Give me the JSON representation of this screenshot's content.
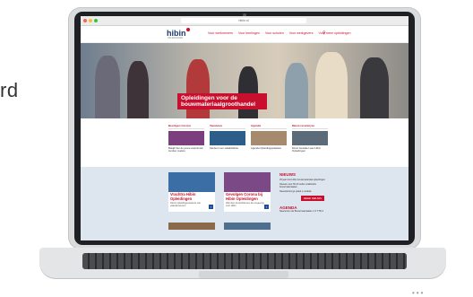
{
  "edge_text": "rd",
  "browser": {
    "url": "hibin.nl"
  },
  "site": {
    "logo": "hibin",
    "logo_sub": "OPLEIDINGEN",
    "menu": [
      "Voor werknemers",
      "Voor leerlingen",
      "Voor scholen",
      "Voor werkgevers",
      "Voor meer opleidingen"
    ],
    "hero_title": "Opleidingen voor de bouwmateriaalgroothandel",
    "cards": [
      {
        "heading": "Bevolgen Corona",
        "text": "Bekijk hier de jeune ewsmirnok tocofen zeelsro",
        "img_color": "#7a3f7c"
      },
      {
        "heading": "Vacatures",
        "text": "Student voor vakafdelinke",
        "img_color": "#2f5d8a"
      },
      {
        "heading": "Agenda",
        "text": "Agenda  Opleidingsplaatsen",
        "img_color": "#a58a6e"
      },
      {
        "heading": "Meest recentnyze",
        "text": "Direct bestellen aan Hibin Opleidingen",
        "img_color": "#5b6b7a"
      }
    ],
    "promos": [
      {
        "title": "Vrachtra Hibin Opleidingen",
        "sub": "Direct opleidingsvacature van vakvakmensen",
        "img_color": "#3b6ea5"
      },
      {
        "title": "Gevolgen Corona bij Hibin Opleidingen",
        "sub": "Wat zien bezproblemen de omgeving voor Hibin",
        "img_color": "#7b4a86"
      }
    ],
    "news": {
      "heading": "NIEUWS",
      "items": [
        "25 jaar dus Hibin bouwmateriaal opleidingen",
        "Nieuwe voor 60 dit seiter praktische bouwmateriaalen",
        "Nieuwsbrief ge prakti e module"
      ],
      "button": "MEER NIEUWS",
      "agenda_heading": "AGENDA",
      "agenda_item": "Nascenten de Bouwmateriaalen 1 4 TTR 2"
    }
  },
  "colors": {
    "brand_red": "#c8102e",
    "brand_blue": "#1b3a6b",
    "band_bg": "#dde5ee"
  }
}
